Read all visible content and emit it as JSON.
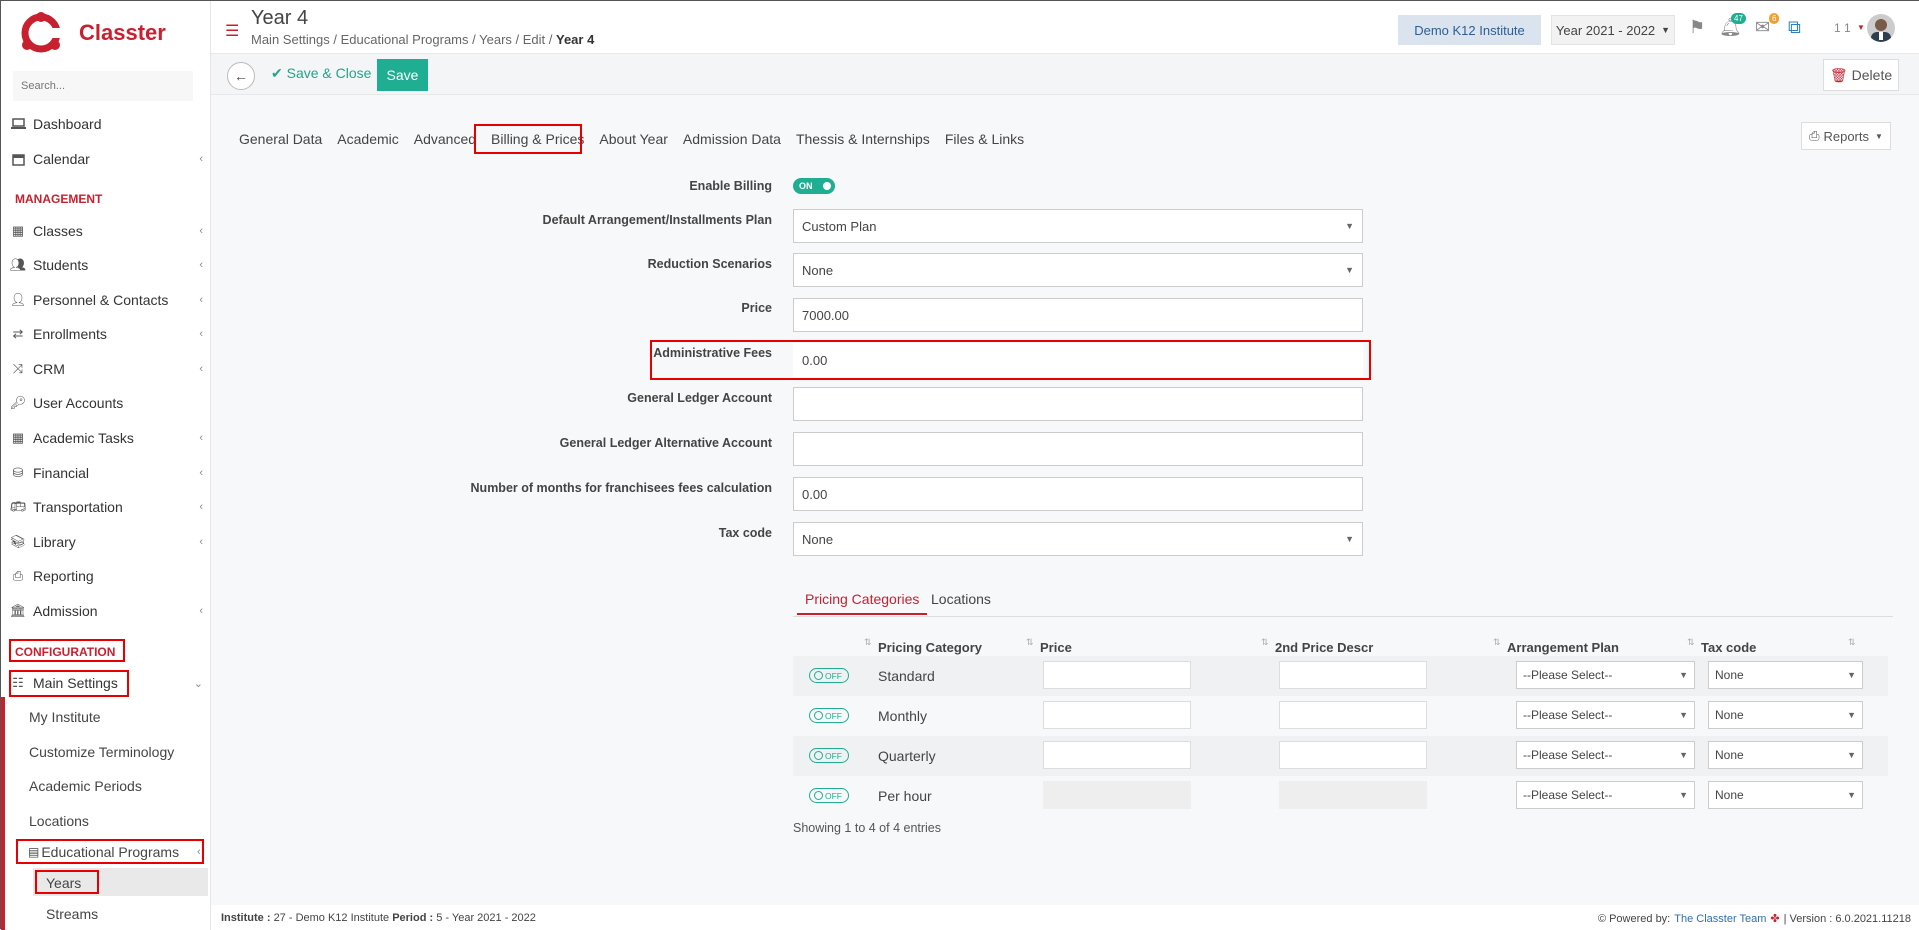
{
  "brand": {
    "name": "Classter"
  },
  "sidebar": {
    "search_placeholder": "Search...",
    "items": [
      {
        "label": "Dashboard",
        "icon": "laptop-icon"
      },
      {
        "label": "Calendar",
        "icon": "calendar-icon"
      }
    ],
    "section_management": "MANAGEMENT",
    "management": [
      {
        "label": "Classes",
        "icon": "classes-icon"
      },
      {
        "label": "Students",
        "icon": "students-icon"
      },
      {
        "label": "Personnel & Contacts",
        "icon": "personnel-icon"
      },
      {
        "label": "Enrollments",
        "icon": "exchange-icon"
      },
      {
        "label": "CRM",
        "icon": "crm-icon"
      },
      {
        "label": "User Accounts",
        "icon": "key-icon"
      },
      {
        "label": "Academic Tasks",
        "icon": "grid-icon"
      },
      {
        "label": "Financial",
        "icon": "coins-icon"
      },
      {
        "label": "Transportation",
        "icon": "bus-icon"
      },
      {
        "label": "Library",
        "icon": "books-icon"
      },
      {
        "label": "Reporting",
        "icon": "printer-icon"
      },
      {
        "label": "Admission",
        "icon": "bank-icon"
      }
    ],
    "section_configuration": "CONFIGURATION",
    "main_settings": "Main Settings",
    "sub_items": [
      "My Institute",
      "Customize Terminology",
      "Academic Periods",
      "Locations"
    ],
    "educational_programs": "Educational Programs",
    "years": "Years",
    "streams": "Streams"
  },
  "header": {
    "title": "Year 4",
    "breadcrumb": [
      "Main Settings",
      "Educational Programs",
      "Years",
      "Edit"
    ],
    "breadcrumb_current": "Year 4",
    "institute": "Demo K12 Institute",
    "year": "Year 2021 - 2022",
    "notif_count": "47",
    "mail_count": "6",
    "user_short": "1 1"
  },
  "toolbar": {
    "save_close": "Save & Close",
    "save": "Save",
    "delete": "Delete"
  },
  "tabs": [
    "General Data",
    "Academic",
    "Advanced",
    "Billing & Prices",
    "About Year",
    "Admission Data",
    "Thessis & Internships",
    "Files & Links"
  ],
  "reports": "Reports",
  "form": {
    "enable_billing": {
      "label": "Enable Billing",
      "value": "ON"
    },
    "arrangement": {
      "label": "Default Arrangement/Installments Plan",
      "value": "Custom Plan"
    },
    "reduction": {
      "label": "Reduction Scenarios",
      "value": "None"
    },
    "price": {
      "label": "Price",
      "value": "7000.00"
    },
    "admin_fees": {
      "label": "Administrative Fees",
      "value": "0.00"
    },
    "gl_account": {
      "label": "General Ledger Account",
      "value": ""
    },
    "gl_alt_account": {
      "label": "General Ledger Alternative Account",
      "value": ""
    },
    "months": {
      "label": "Number of months for franchisees fees calculation",
      "value": "0.00"
    },
    "tax": {
      "label": "Tax code",
      "value": "None"
    }
  },
  "pricing": {
    "tabs": [
      "Pricing Categories",
      "Locations"
    ],
    "columns": [
      "Pricing Category",
      "Price",
      "2nd Price Descr",
      "Arrangement Plan",
      "Tax code"
    ],
    "rows": [
      {
        "toggle": "OFF",
        "category": "Standard",
        "plan": "--Please Select--",
        "tax": "None"
      },
      {
        "toggle": "OFF",
        "category": "Monthly",
        "plan": "--Please Select--",
        "tax": "None"
      },
      {
        "toggle": "OFF",
        "category": "Quarterly",
        "plan": "--Please Select--",
        "tax": "None"
      },
      {
        "toggle": "OFF",
        "category": "Per hour",
        "plan": "--Please Select--",
        "tax": "None"
      }
    ],
    "showing": "Showing 1 to 4 of 4 entries"
  },
  "footer": {
    "institute_label": "Institute :",
    "institute_value": "27 - Demo K12 Institute",
    "period_label": "Period :",
    "period_value": "5 - Year 2021 - 2022",
    "powered": "Powered by:",
    "team": "The Classter Team",
    "version": "| Version : 6.0.2021.11218"
  },
  "colors": {
    "brand": "#c8202f",
    "accent": "#1fae92",
    "highlight": "#e60000"
  }
}
